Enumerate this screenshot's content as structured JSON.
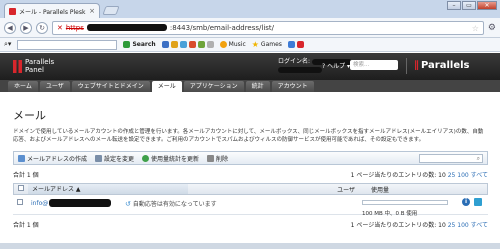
{
  "browser": {
    "tab_title": "メール - Parallels Plesk",
    "tab_close": "×",
    "win_min": "–",
    "win_max": "▭",
    "win_close": "✕",
    "url_scheme": "https",
    "url_rest": ":8443/smb/email-address/list/"
  },
  "bookmarks": {
    "search_label": "Search",
    "music_label": "Music",
    "games_label": "Games"
  },
  "header": {
    "logo_line1": "Parallels",
    "logo_line2": "Panel",
    "login_label": "ログイン名: ",
    "help_label": "ヘルプ",
    "search_placeholder": "検索...",
    "brand": "Parallels"
  },
  "nav": {
    "tabs": [
      {
        "label": "ホーム"
      },
      {
        "label": "ユーザ"
      },
      {
        "label": "ウェブサイトとドメイン"
      },
      {
        "label": "メール"
      },
      {
        "label": "アプリケーション"
      },
      {
        "label": "統計"
      },
      {
        "label": "アカウント"
      }
    ]
  },
  "page": {
    "title": "メール",
    "description": "ドメインで使用しているメールアカウントの作成と管理を行います。各メールアカウントに対して、メールボックス、同じメールボックスを指すメールアドレス(メールエイリアス)の数、自動応答、およびメールアドレスへのメール転送を設定できます。ご利用のアカウントでスパムおよびウィルスの防御サービスが使用可能であれば、その設定もできます。"
  },
  "actions": {
    "create": "メールアドレスの作成",
    "change_settings": "設定を変更",
    "refresh_stats": "使用量統計を更新",
    "delete": "削除",
    "search_icon": "⌕"
  },
  "list": {
    "total": "合計 1 個",
    "per_page_label": "1 ページ当たりのエントリの数: ",
    "per_page_10": "10",
    "per_page_25": "25",
    "per_page_100": "100",
    "per_page_all": "すべて",
    "columns": {
      "email": "メールアドレス ▲",
      "user": "ユーザ",
      "usage": "使用量"
    },
    "rows": [
      {
        "email_prefix": "info@",
        "autoresponder": "自動応答は有効になっています",
        "usage_text": "100 MB 中、0 B 使用",
        "usage_fraction": 0
      }
    ]
  },
  "colors": {
    "plesk_red": "#d8262c",
    "link_blue": "#2a6db5",
    "header_dark": "#2a2a2a"
  }
}
